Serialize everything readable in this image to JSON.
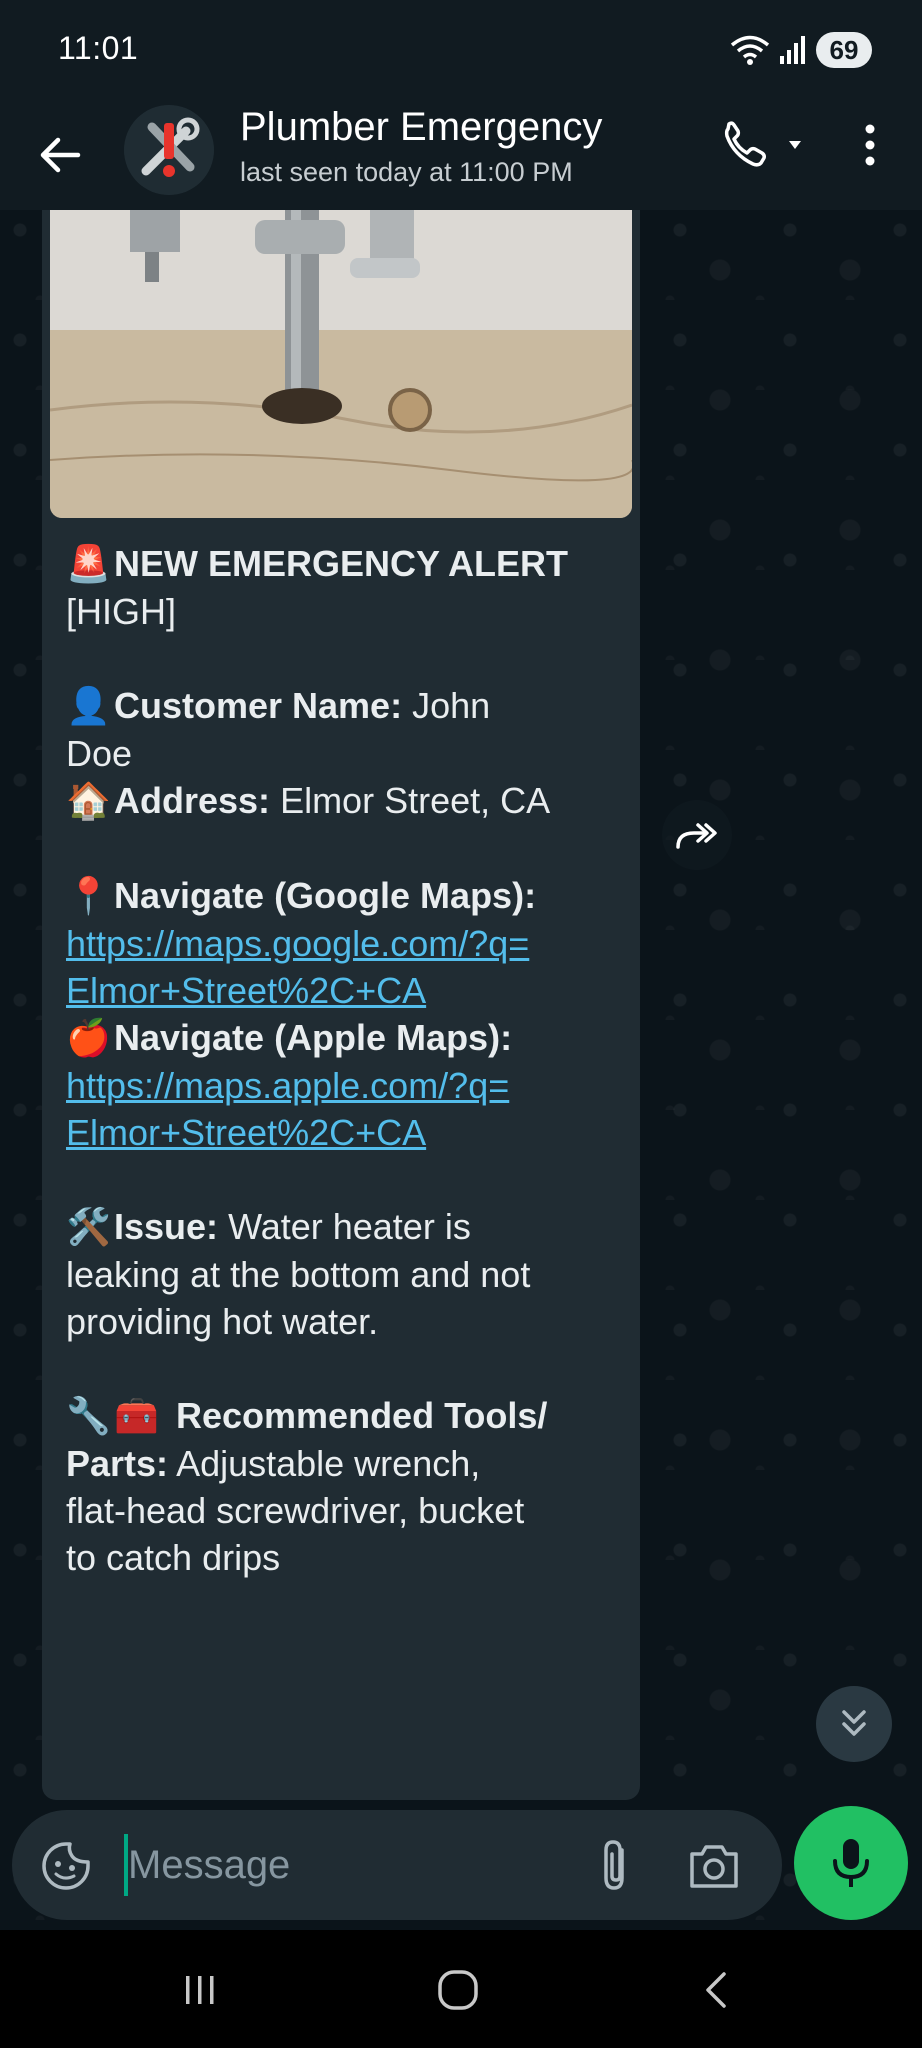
{
  "status_bar": {
    "time": "11:01",
    "battery": "69"
  },
  "header": {
    "title": "Plumber Emergency",
    "subtitle": "last seen today at 11:00 PM"
  },
  "message": {
    "line_alert": "NEW EMERGENCY ALERT",
    "line_priority": "[HIGH]",
    "customer_label": "Customer Name:",
    "customer_value": "John",
    "customer_value_cont": "Doe",
    "address_label": "Address:",
    "address_value": "Elmor Street, CA",
    "google_label": "Navigate (Google Maps):",
    "google_url_1": "https://maps.google.com/?q=",
    "google_url_2": "Elmor+Street%2C+CA",
    "apple_label": "Navigate (Apple Maps):",
    "apple_url_1": "https://maps.apple.com/?q=",
    "apple_url_2": "Elmor+Street%2C+CA",
    "issue_label": "Issue:",
    "issue_value_1": "Water heater is",
    "issue_value_2": "leaking at the bottom and not",
    "issue_value_3": "providing hot water.",
    "tools_label_1": "Recommended Tools/",
    "tools_label_2": "Parts:",
    "tools_value_1": "Adjustable wrench,",
    "tools_value_2": "flat-head screwdriver, bucket",
    "tools_value_3": "to catch drips",
    "emoji": {
      "alert": "🚨",
      "customer": "👤",
      "address": "🏠",
      "pin": "📍",
      "apple": "🍎",
      "issue": "🛠️",
      "wrench": "🔧",
      "toolbox": "🧰"
    }
  },
  "input": {
    "placeholder": "Message"
  },
  "colors": {
    "accent": "#00a884",
    "mic": "#21c063",
    "link": "#53bdeb",
    "bubble": "#202c33",
    "background": "#0b141a"
  },
  "icons": {
    "back": "arrow-left-icon",
    "call": "phone-icon",
    "menu": "more-vert-icon",
    "forward": "forward-icon",
    "scroll_down": "chevrons-down-icon",
    "emoji": "sticker-icon",
    "attach": "paperclip-icon",
    "camera": "camera-icon",
    "mic": "mic-icon"
  }
}
